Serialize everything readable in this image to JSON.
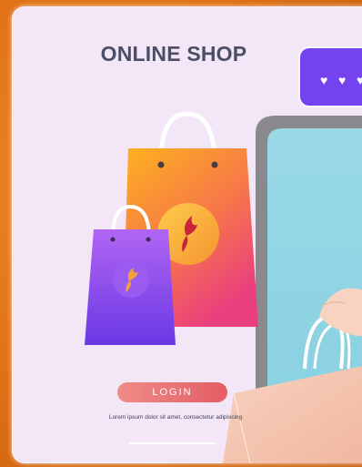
{
  "header": {
    "title": "ONLINE SHOP"
  },
  "actions": {
    "login_label": "LOGIN"
  },
  "caption": "Lorem ipsum dolor sit amet, consectetur adipiscing",
  "icons": {
    "bag_large": "shopping-bag-icon",
    "bag_small": "shopping-bag-icon",
    "logo": "f-logo-icon",
    "heart": "heart-icon"
  },
  "colors": {
    "background": "#f3e6f7",
    "frame": "#e47a1c",
    "title": "#4a4f66",
    "login_gradient_start": "#ef8b86",
    "login_gradient_end": "#e45d64",
    "bubble": "#7243ee",
    "phone_screen": "#93d7e4"
  }
}
